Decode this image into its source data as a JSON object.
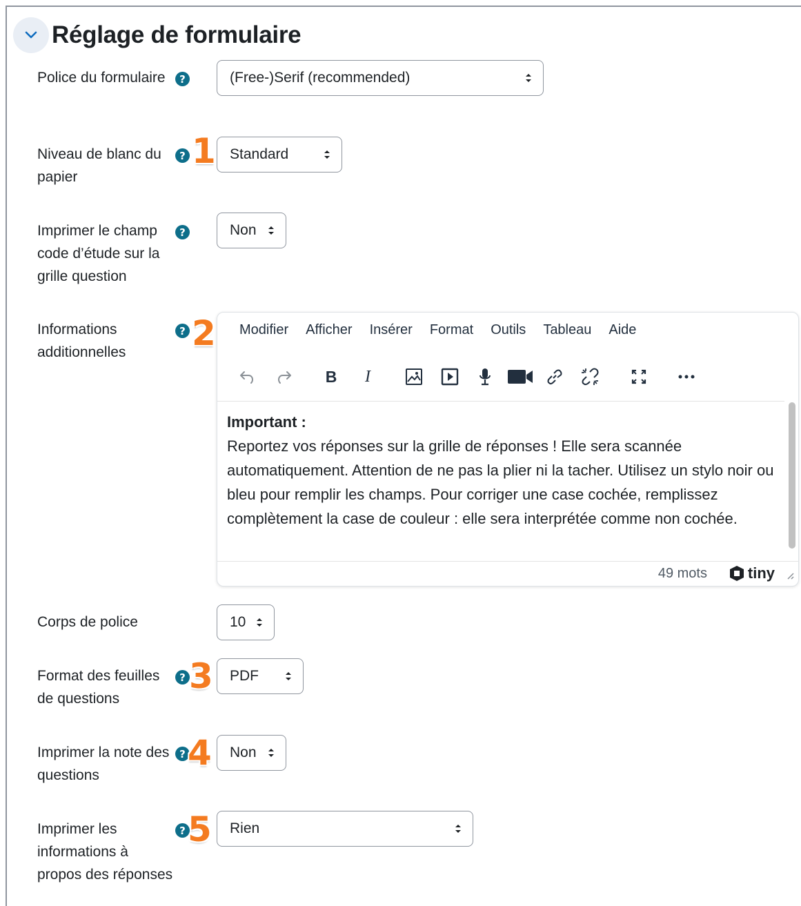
{
  "section": {
    "title": "Réglage de formulaire"
  },
  "fields": {
    "font": {
      "label": "Police du formulaire",
      "value": "(Free-)Serif (recommended)"
    },
    "paper_white": {
      "label": "Niveau de blanc du papier",
      "value": "Standard",
      "marker": "1"
    },
    "print_code": {
      "label": "Imprimer le champ code d’étude sur la grille question",
      "value": "Non"
    },
    "additional_info": {
      "label": "Informations additionnelles",
      "marker": "2"
    },
    "font_size": {
      "label": "Corps de police",
      "value": "10"
    },
    "sheet_format": {
      "label": "Format des feuilles de questions",
      "value": "PDF",
      "marker": "3"
    },
    "print_grade": {
      "label": "Imprimer la note des questions",
      "value": "Non",
      "marker": "4"
    },
    "print_answer_info": {
      "label": "Imprimer les informations à propos des réponses",
      "value": "Rien",
      "marker": "5"
    }
  },
  "editor": {
    "menu": [
      "Modifier",
      "Afficher",
      "Insérer",
      "Format",
      "Outils",
      "Tableau",
      "Aide"
    ],
    "content_heading": "Important :",
    "content_body": "Reportez vos réponses sur la grille de réponses ! Elle sera scannée automatiquement. Attention de ne pas la plier ni la tacher. Utilisez un stylo noir ou bleu pour remplir les champs. Pour corriger une case cochée, remplissez complètement la case de couleur : elle sera interprétée comme non cochée.",
    "word_count": "49 mots",
    "brand": "tiny"
  },
  "icons": {
    "collapse": "chevron-down-icon",
    "help": "question-circle-icon",
    "toolbar": [
      "undo-icon",
      "redo-icon",
      "bold-icon",
      "italic-icon",
      "image-icon",
      "media-icon",
      "microphone-icon",
      "video-camera-icon",
      "link-icon",
      "unlink-icon",
      "fullscreen-icon",
      "more-icon"
    ]
  },
  "colors": {
    "help": "#0d6e8a",
    "marker": "#f47b20",
    "collapse_bg": "#e9eef5"
  }
}
